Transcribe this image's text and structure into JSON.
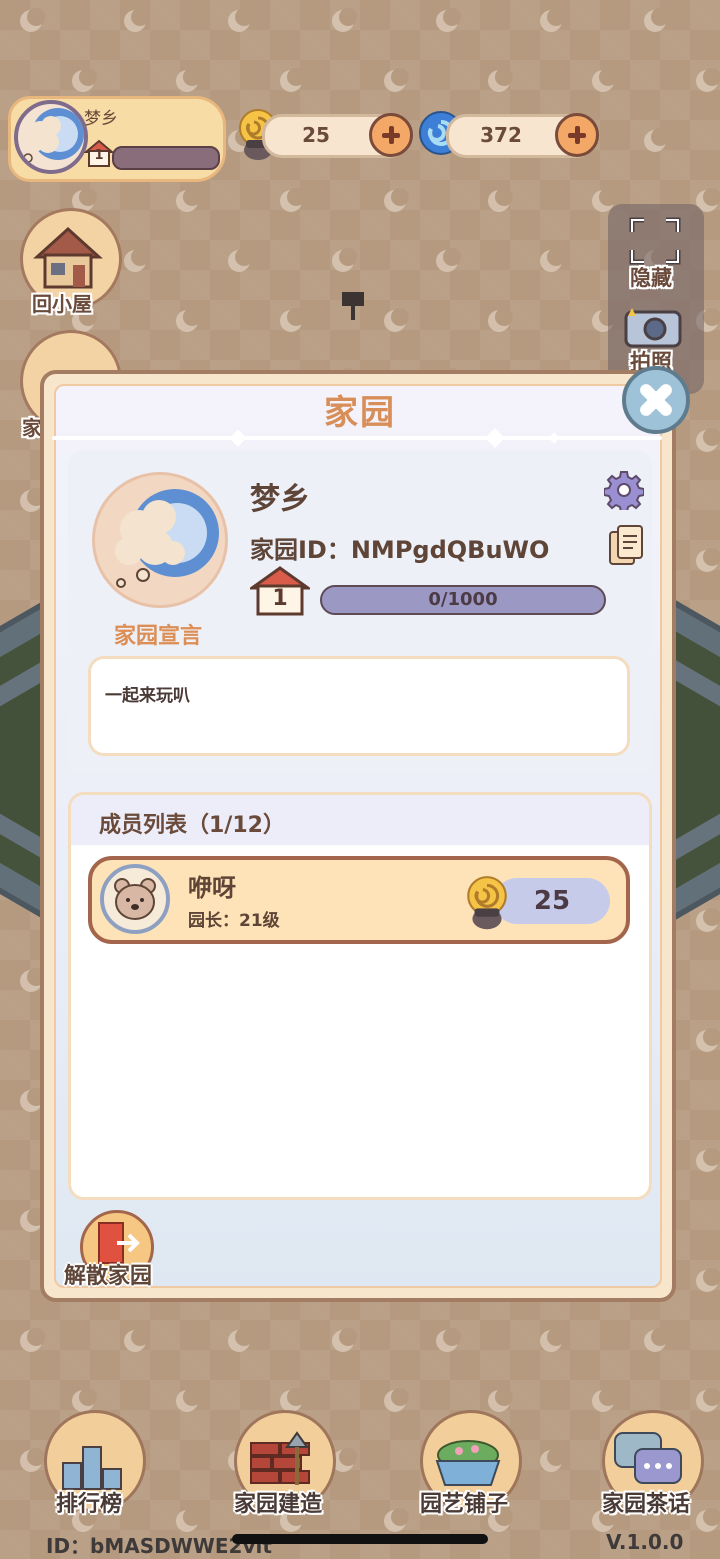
{
  "player": {
    "name": "梦乡",
    "level": "1"
  },
  "currency": {
    "snail": "25",
    "swirl": "372"
  },
  "side": {
    "home_label": "回小屋",
    "hide_label": "隐藏",
    "photo_label": "拍照",
    "left2_label": "家"
  },
  "dialog": {
    "title": "家园",
    "garden_name": "梦乡",
    "garden_id": "家园ID：NMPgdQBuWO",
    "level": "1",
    "exp_text": "0/1000",
    "exp_fraction": 0,
    "declaration_label": "家园宣言",
    "declaration_text": "一起来玩叭",
    "members_title": "成员列表（1/12）",
    "members": [
      {
        "name": "咿呀",
        "role": "园长：21级",
        "score": "25"
      }
    ],
    "disband_label": "解散家园"
  },
  "nav": {
    "rank": "排行榜",
    "build": "家园建造",
    "shop": "园艺铺子",
    "tea": "家园茶话"
  },
  "footer": {
    "id": "ID：bMASDWWE2vlt",
    "version": "V.1.0.0"
  },
  "colors": {
    "accent": "#d88e58",
    "frame": "#a37d63",
    "panel": "#f8e6cc"
  }
}
